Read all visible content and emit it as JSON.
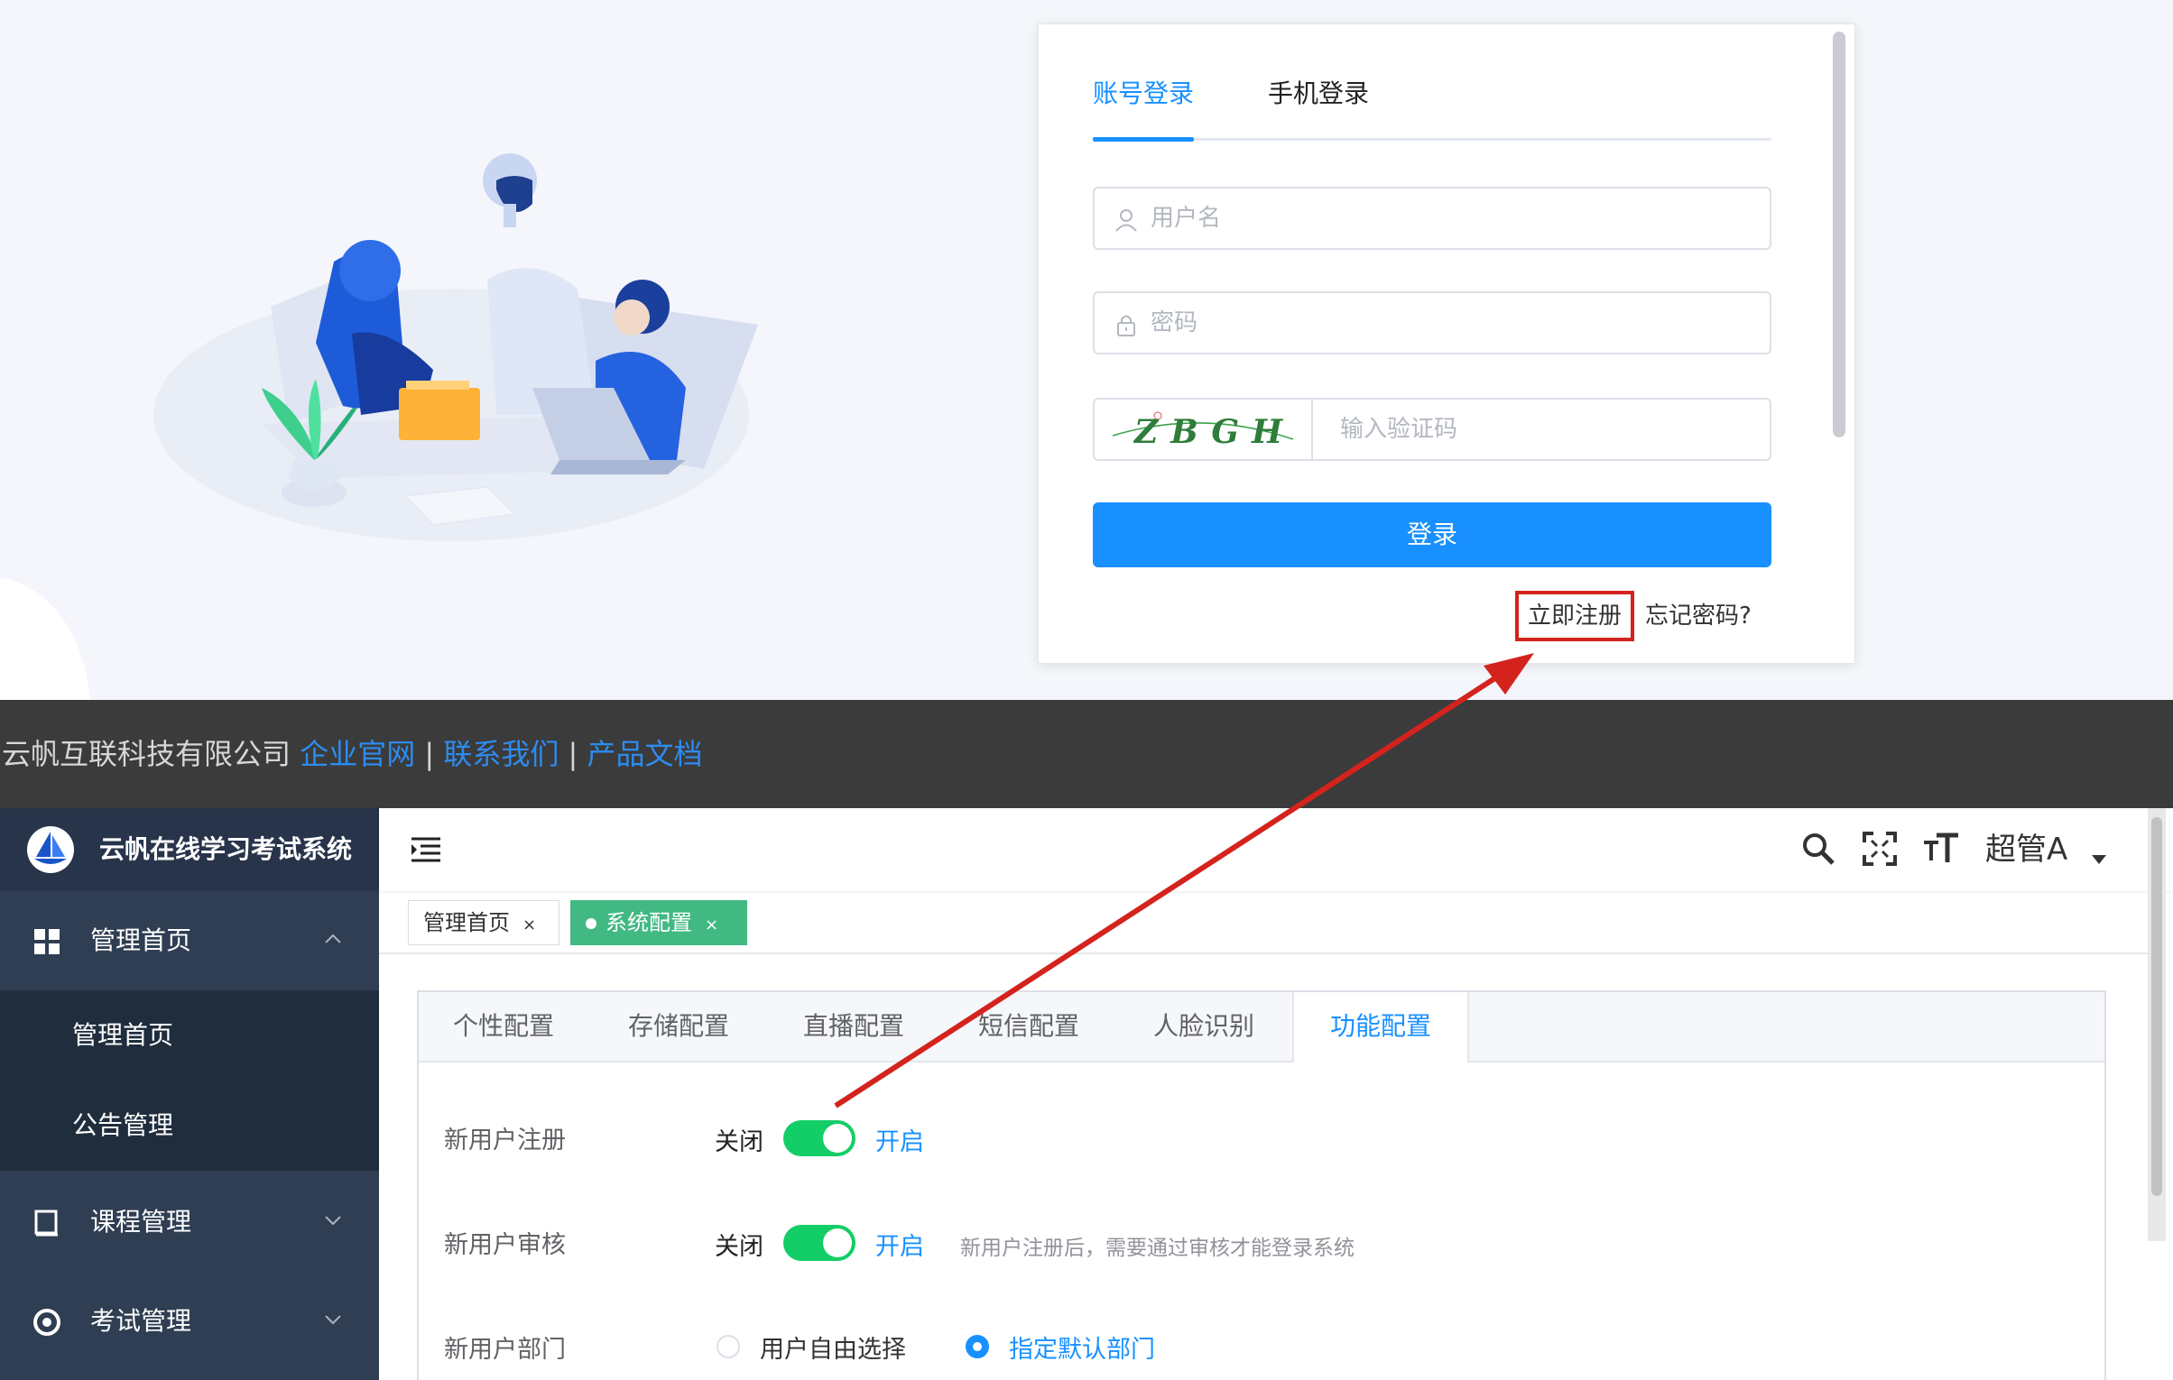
{
  "login": {
    "tabs": [
      {
        "label": "账号登录",
        "active": true
      },
      {
        "label": "手机登录",
        "active": false
      }
    ],
    "username_placeholder": "用户名",
    "password_placeholder": "密码",
    "captcha_text": "ZBGH",
    "captcha_placeholder": "输入验证码",
    "login_button": "登录",
    "register_link": "立即注册",
    "forgot_link": "忘记密码?",
    "accent_color": "#1890ff",
    "highlight_color": "#d4231d"
  },
  "footer": {
    "company": "京云帆互联科技有限公司",
    "links": [
      "企业官网",
      "联系我们",
      "产品文档"
    ],
    "separator": "|"
  },
  "admin": {
    "brand": "云帆在线学习考试系统",
    "sidebar": {
      "groups": [
        {
          "label": "管理首页",
          "icon": "dashboard-icon",
          "expanded": true,
          "children": [
            "管理首页",
            "公告管理"
          ]
        },
        {
          "label": "课程管理",
          "icon": "book-icon",
          "expanded": false
        },
        {
          "label": "考试管理",
          "icon": "exam-icon",
          "expanded": false
        }
      ]
    },
    "topbar": {
      "user": "超管A"
    },
    "tags": [
      {
        "label": "管理首页",
        "close": "×"
      },
      {
        "label": "系统配置",
        "close": "×",
        "active": true
      }
    ],
    "config_tabs": [
      {
        "label": "个性配置"
      },
      {
        "label": "存储配置"
      },
      {
        "label": "直播配置"
      },
      {
        "label": "短信配置"
      },
      {
        "label": "人脸识别"
      },
      {
        "label": "功能配置",
        "active": true
      }
    ],
    "rows": {
      "register": {
        "label": "新用户注册",
        "off": "关闭",
        "on": "开启",
        "enabled": true
      },
      "audit": {
        "label": "新用户审核",
        "off": "关闭",
        "on": "开启",
        "enabled": true,
        "hint": "新用户注册后，需要通过审核才能登录系统"
      },
      "department": {
        "label": "新用户部门",
        "options": [
          "用户自由选择",
          "指定默认部门"
        ],
        "selected": 1
      }
    },
    "toggle_color": "#13ce66"
  }
}
